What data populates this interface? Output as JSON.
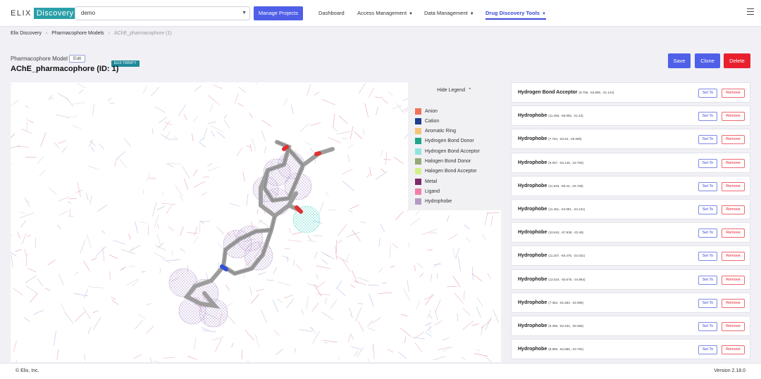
{
  "navbar": {
    "logo_part1": "ELIX",
    "logo_part2": "Discovery",
    "project_select_value": "demo",
    "manage_projects_label": "Manage Projects",
    "links": [
      {
        "label": "Dashboard",
        "has_caret": false,
        "active": false
      },
      {
        "label": "Access Management",
        "has_caret": true,
        "active": false
      },
      {
        "label": "Data Management",
        "has_caret": true,
        "active": false
      },
      {
        "label": "Drug Discovery Tools",
        "has_caret": true,
        "active": true
      }
    ],
    "menu_icon": "hamburger-menu-icon"
  },
  "breadcrumb": [
    "Elix Discovery",
    "Pharmacophore Models",
    "AChE_pharmacophore (1)"
  ],
  "header": {
    "model_label": "Pharmacophore Model",
    "edit_label": "Edit",
    "badge": "ELIX TRINITY",
    "title": "AChE_pharmacophore (ID: 1)",
    "save_label": "Save",
    "clone_label": "Clone",
    "delete_label": "Delete"
  },
  "legend": {
    "toggle_label": "Hide Legend",
    "toggle_icon": "double-chevron-up-icon",
    "items": [
      {
        "label": "Anion",
        "color": "#f07359"
      },
      {
        "label": "Cation",
        "color": "#1e3d8f"
      },
      {
        "label": "Aromatic Ring",
        "color": "#f6c47a"
      },
      {
        "label": "Hydrogen Bond Donor",
        "color": "#21a58b"
      },
      {
        "label": "Hydrogen Bond Acceptor",
        "color": "#8fe6dd"
      },
      {
        "label": "Halogen Bond Donor",
        "color": "#95a97a"
      },
      {
        "label": "Halogen Bond Acceptor",
        "color": "#d3f08a"
      },
      {
        "label": "Metal",
        "color": "#7e2a6b"
      },
      {
        "label": "Ligand",
        "color": "#ef7fa8"
      },
      {
        "label": "Hydrophobe",
        "color": "#b59ac7"
      }
    ]
  },
  "features": [
    {
      "name": "Hydrogen Bond Acceptor",
      "coords": "(9.795, -53.895, -21.144)"
    },
    {
      "name": "Hydrophobe",
      "coords": "(11.268, -58.905, -21.43)"
    },
    {
      "name": "Hydrophobe",
      "coords": "(7.764, -63.54, -25.089)"
    },
    {
      "name": "Hydrophobe",
      "coords": "(9.067, -63.145, -22.793)"
    },
    {
      "name": "Hydrophobe",
      "coords": "(11.549, -58.34, -23.738)"
    },
    {
      "name": "Hydrophobe",
      "coords": "(11.461, -54.991, -24.131)"
    },
    {
      "name": "Hydrophobe",
      "coords": "(10.842, -57.938, -22.49)"
    },
    {
      "name": "Hydrophobe",
      "coords": "(11.207, -56.475, -22.031)"
    },
    {
      "name": "Hydrophobe",
      "coords": "(12.524, -53.676, -24.884)"
    },
    {
      "name": "Hydrophobe",
      "coords": "(7.353, -61.684, -22.599)"
    },
    {
      "name": "Hydrophobe",
      "coords": "(9.398, -62.434, -25.055)"
    },
    {
      "name": "Hydrophobe",
      "coords": "(9.889, -62.585, -23.794)"
    }
  ],
  "feature_buttons": {
    "set_to": "Set To",
    "remove": "Remove"
  },
  "footer": {
    "copyright": "© Elix, Inc.",
    "version": "Version 2.18.0"
  }
}
